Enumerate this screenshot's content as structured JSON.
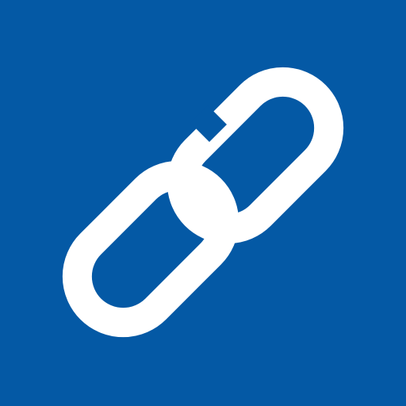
{
  "icon": {
    "name": "link-icon",
    "background_color": "#0459A5",
    "glyph_color": "#FFFFFF"
  }
}
